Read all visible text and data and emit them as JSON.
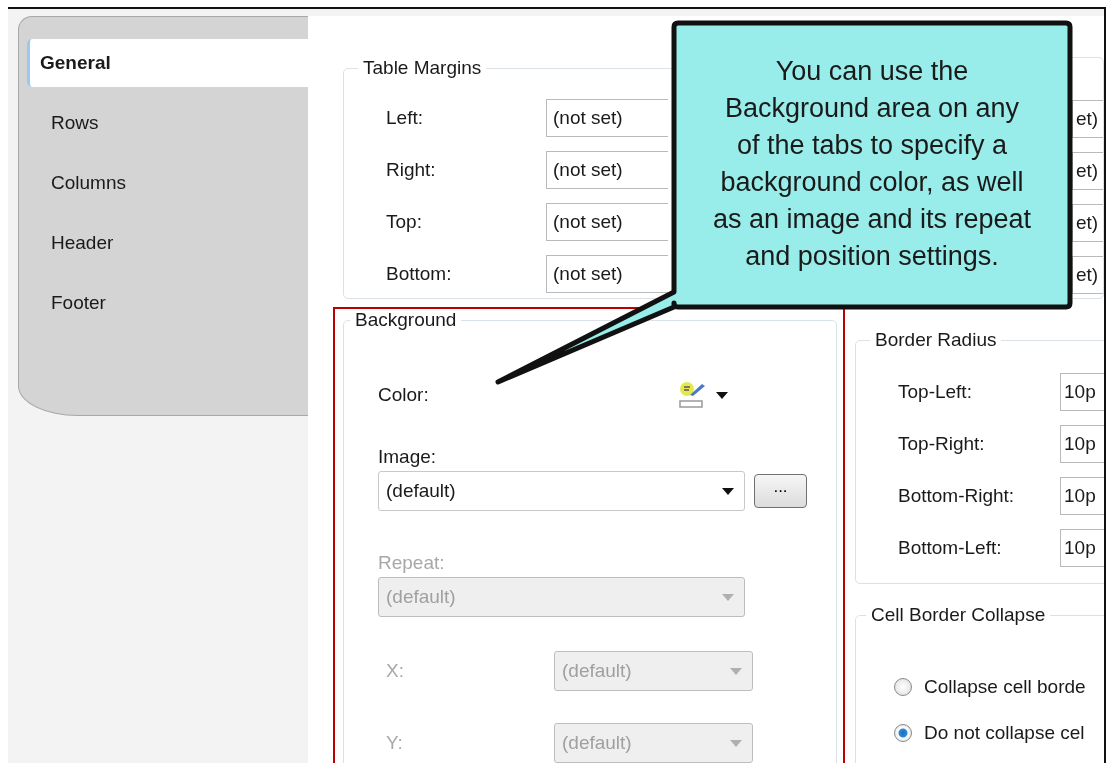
{
  "tabs": [
    {
      "label": "General",
      "selected": true
    },
    {
      "label": "Rows",
      "selected": false
    },
    {
      "label": "Columns",
      "selected": false
    },
    {
      "label": "Header",
      "selected": false
    },
    {
      "label": "Footer",
      "selected": false
    }
  ],
  "table_margins": {
    "title": "Table Margins",
    "fields": [
      {
        "label": "Left:",
        "value": "(not set)"
      },
      {
        "label": "Right:",
        "value": "(not set)"
      },
      {
        "label": "Top:",
        "value": "(not set)"
      },
      {
        "label": "Bottom:",
        "value": "(not set)"
      }
    ]
  },
  "column_2_fields": [
    {
      "value": "et)"
    },
    {
      "value": "et)"
    },
    {
      "value": "et)"
    },
    {
      "value": "et)"
    }
  ],
  "callout": {
    "text": "You can use the\nBackground area on any\nof the tabs to specify a\nbackground color, as well\nas an image and its repeat\nand position settings."
  },
  "background": {
    "title": "Background",
    "highlighted": true,
    "color": {
      "label": "Color:"
    },
    "image": {
      "label": "Image:",
      "value": "(default)",
      "disabled": false
    },
    "browse_button": "...",
    "repeat": {
      "label": "Repeat:",
      "value": "(default)",
      "disabled": true
    },
    "x": {
      "label": "X:",
      "value": "(default)",
      "disabled": true
    },
    "y": {
      "label": "Y:",
      "value": "(default)",
      "disabled": true
    }
  },
  "border_radius": {
    "title": "Border Radius",
    "fields": [
      {
        "label": "Top-Left:",
        "value": "10p"
      },
      {
        "label": "Top-Right:",
        "value": "10p"
      },
      {
        "label": "Bottom-Right:",
        "value": "10p"
      },
      {
        "label": "Bottom-Left:",
        "value": "10p"
      }
    ]
  },
  "cell_border_collapse": {
    "title": "Cell Border Collapse",
    "options": [
      {
        "label": "Collapse cell borde",
        "selected": false
      },
      {
        "label": "Do not collapse cel",
        "selected": true
      }
    ]
  }
}
